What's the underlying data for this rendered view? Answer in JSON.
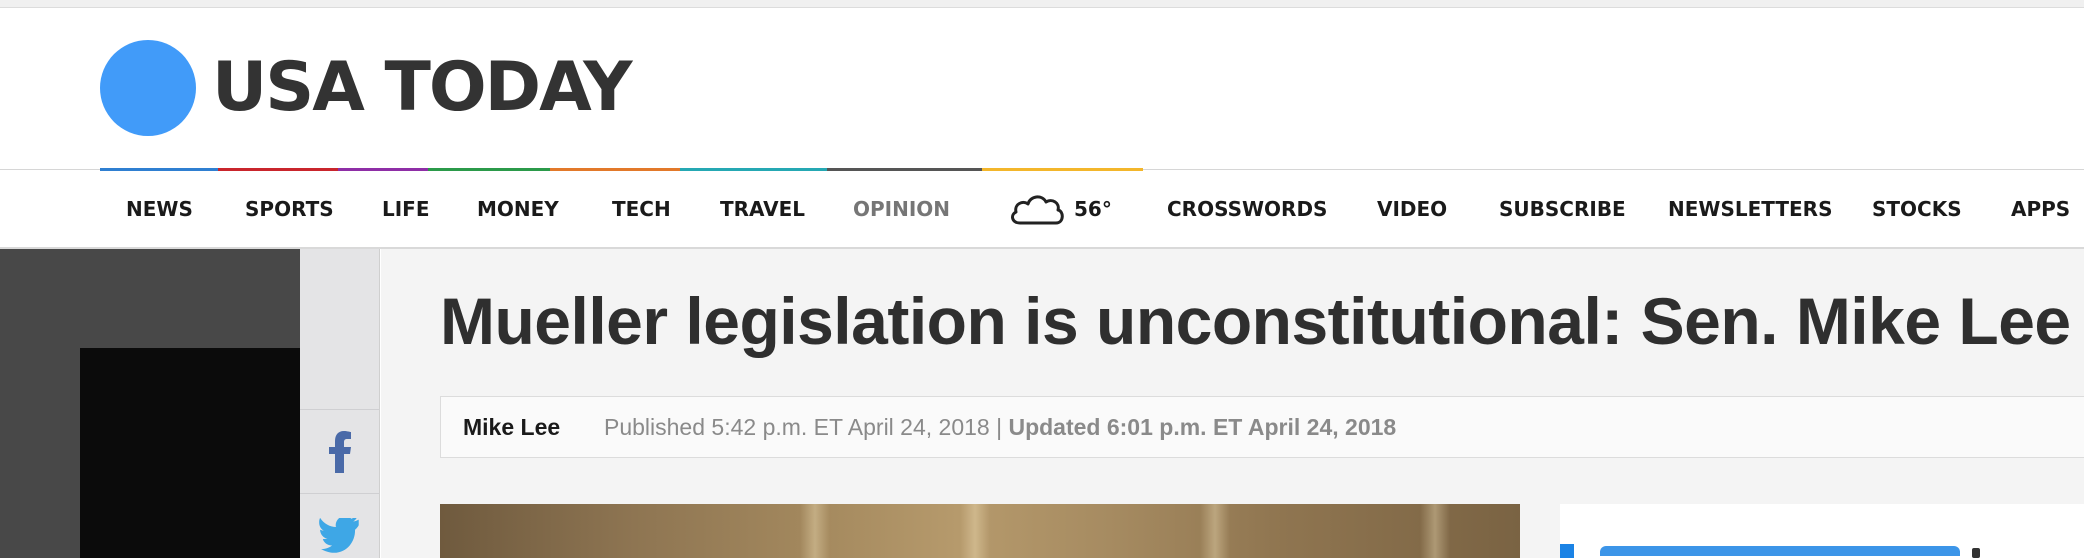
{
  "masthead": {
    "logo_text": "USA TODAY",
    "logo_color": "#419bf9"
  },
  "nav": {
    "items": [
      {
        "label": "NEWS",
        "color": "#2f7fd1"
      },
      {
        "label": "SPORTS",
        "color": "#c9252c"
      },
      {
        "label": "LIFE",
        "color": "#8e2ea6"
      },
      {
        "label": "MONEY",
        "color": "#2b9a4a"
      },
      {
        "label": "TECH",
        "color": "#e2792a"
      },
      {
        "label": "TRAVEL",
        "color": "#25a8b3"
      },
      {
        "label": "OPINION",
        "color": "#555555"
      }
    ],
    "weather": {
      "icon": "cloud-icon",
      "temp": "56°",
      "color": "#f3b62b"
    },
    "more_items": [
      "CROSSWORDS",
      "VIDEO",
      "SUBSCRIBE",
      "NEWSLETTERS",
      "STOCKS",
      "APPS"
    ]
  },
  "share": {
    "facebook_icon": "facebook-icon",
    "twitter_icon": "twitter-icon"
  },
  "article": {
    "headline": "Mueller legislation is unconstitutional: Sen. Mike Lee",
    "author": "Mike Lee",
    "published": "Published 5:42 p.m. ET April 24, 2018 | ",
    "updated": "Updated 6:01 p.m. ET April 24, 2018"
  }
}
